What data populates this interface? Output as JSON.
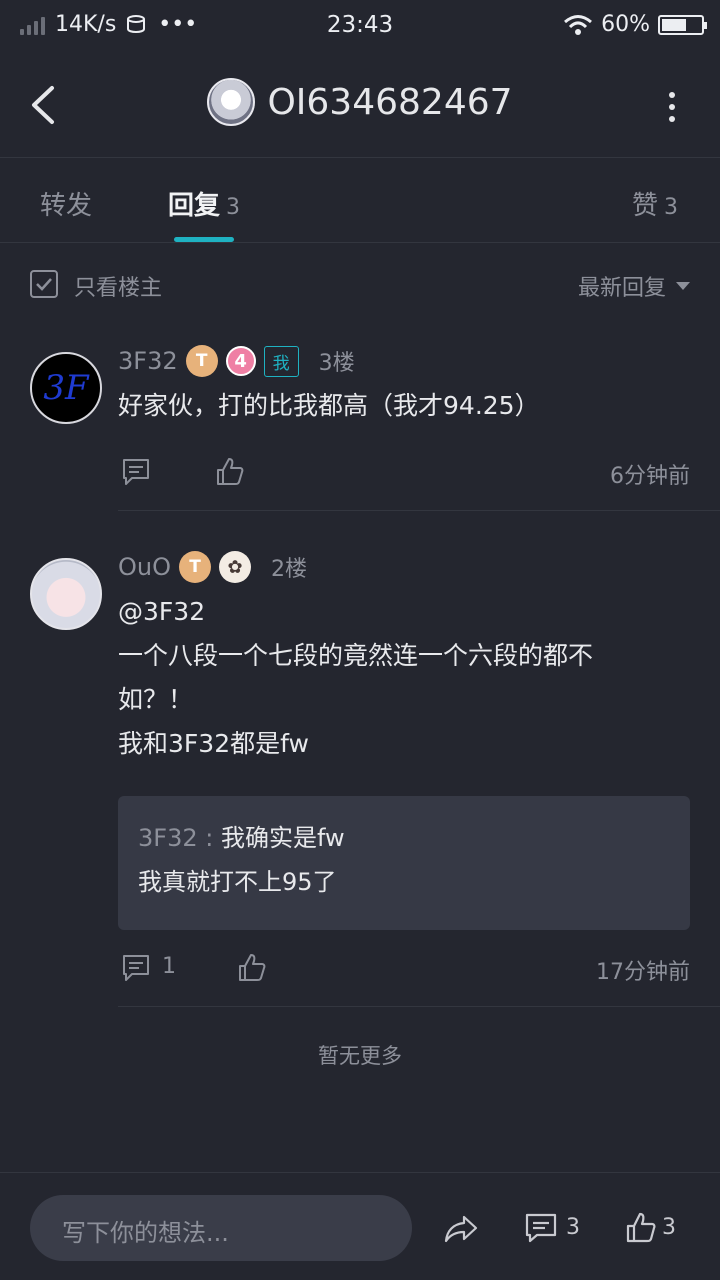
{
  "status": {
    "speed": "14K/s",
    "dots": "•••",
    "time": "23:43",
    "battery": "60%"
  },
  "header": {
    "title": "OI634682467"
  },
  "tabs": [
    {
      "label": "转发",
      "count": ""
    },
    {
      "label": "回复",
      "count": "3"
    },
    {
      "label": "赞",
      "count": "3"
    }
  ],
  "filter": {
    "only_op": "只看楼主",
    "sort": "最新回复"
  },
  "posts": [
    {
      "user": "3F32",
      "avatar_text": "3F",
      "badge_t": "T",
      "badge_level": "4",
      "badge_me": "我",
      "floor": "3楼",
      "content": "好家伙，打的比我都高（我才94.25）",
      "time": "6分钟前"
    },
    {
      "user": "OuO",
      "badge_t": "T",
      "floor": "2楼",
      "content_lines": [
        "@3F32",
        "一个八段一个七段的竟然连一个六段的都不",
        "如？！",
        "我和3F32都是fw"
      ],
      "quote_user": "3F32",
      "quote_sep": " : ",
      "quote_line1": "我确实是fw",
      "quote_line2": "我真就打不上95了",
      "reply_count": "1",
      "time": "17分钟前"
    }
  ],
  "no_more": "暂无更多",
  "bottom": {
    "placeholder": "写下你的想法...",
    "comment_count": "3",
    "like_count": "3"
  },
  "colors": {
    "background": "#24262f",
    "accent": "#1fb2c2",
    "muted_text": "#8d909a"
  }
}
